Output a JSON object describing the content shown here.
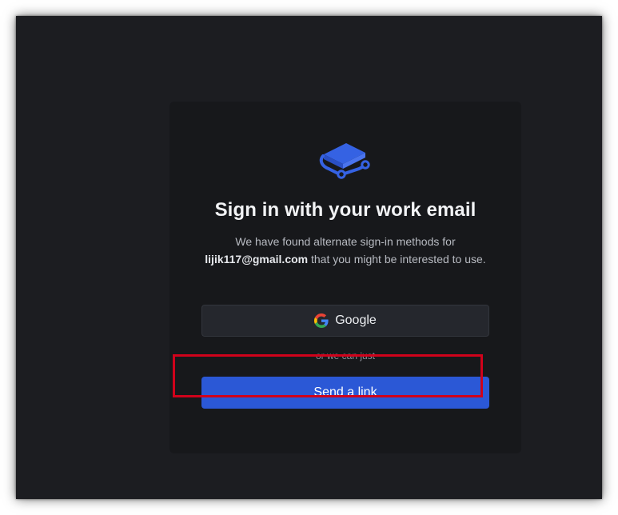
{
  "signin": {
    "title": "Sign in with your work email",
    "description_before": "We have found alternate sign-in methods for",
    "email": "lijik117@gmail.com",
    "description_after": "that you might be interested to use.",
    "google_button_label": "Google",
    "or_text": "or we can just",
    "send_link_label": "Send a link"
  },
  "icons": {
    "logo": "book-logo-icon",
    "google": "google-g-icon"
  },
  "colors": {
    "background": "#1c1d21",
    "card": "#17181b",
    "accent": "#2b58d6",
    "highlight": "#d0021b"
  }
}
